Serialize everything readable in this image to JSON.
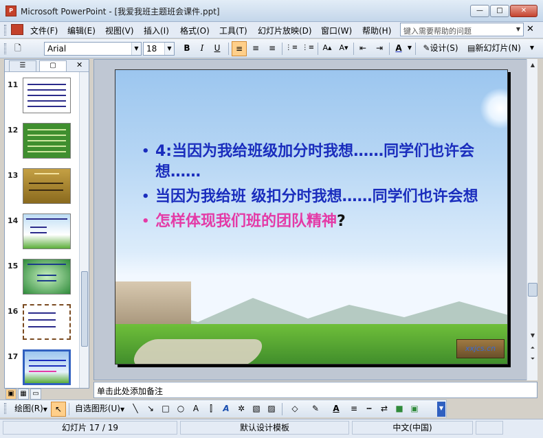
{
  "window": {
    "app_icon": "P",
    "title": "Microsoft PowerPoint - [我爱我班主题班会课件.ppt]",
    "minimize_glyph": "—",
    "maximize_glyph": "□",
    "close_glyph": "✕"
  },
  "menu": {
    "items": [
      "文件(F)",
      "编辑(E)",
      "视图(V)",
      "插入(I)",
      "格式(O)",
      "工具(T)",
      "幻灯片放映(D)",
      "窗口(W)",
      "帮助(H)"
    ],
    "help_placeholder": "键入需要帮助的问题",
    "help_dropdown_glyph": "▼",
    "close_glyph": "✕"
  },
  "toolbar": {
    "new_glyph": "🗋",
    "font": "Arial",
    "font_size": "18",
    "bold": "B",
    "italic": "I",
    "underline": "U",
    "align_left_glyph": "≡",
    "align_center_glyph": "≡",
    "align_right_glyph": "≡",
    "numbering_glyph": "⋮≡",
    "bullets_glyph": "⋮≡",
    "grow_glyph": "A▴",
    "shrink_glyph": "A▾",
    "outdent_glyph": "⇤",
    "indent_glyph": "⇥",
    "font_color_glyph": "A",
    "design_label": "设计(S)",
    "new_slide_label": "新幻灯片(N)"
  },
  "left_pane": {
    "tab_outline_glyph": "☰",
    "tab_slides_glyph": "▢",
    "close_glyph": "✕",
    "thumbnails": [
      {
        "number": "11"
      },
      {
        "number": "12"
      },
      {
        "number": "13"
      },
      {
        "number": "14"
      },
      {
        "number": "15"
      },
      {
        "number": "16"
      },
      {
        "number": "17",
        "selected": true
      }
    ]
  },
  "slide": {
    "bullet_glyph": "•",
    "bullets": [
      {
        "prefix": "4:",
        "text": "当因为我给班级加分时我想……同学们也许会想……",
        "color": "#1a2dbd"
      },
      {
        "prefix": "",
        "text": "当因为我给班 级扣分时我想……同学们也许会想",
        "color": "#1a2dbd"
      },
      {
        "prefix": "",
        "text": "怎样体现我们班的团队精神",
        "suffix": "?",
        "color": "#e43aa6"
      }
    ],
    "logo_text": "xxjcs.cn"
  },
  "notes": {
    "placeholder": "单击此处添加备注"
  },
  "draw_toolbar": {
    "draw_label": "绘图(R)",
    "autoshapes_label": "自选图形(U)",
    "line_glyph": "╲",
    "arrow_glyph": "↘",
    "rect_glyph": "□",
    "oval_glyph": "○",
    "textbox_glyph": "A",
    "fill_glyph": "◇",
    "line_color_glyph": "✎",
    "font_color_glyph": "A",
    "line_style_glyph": "≡",
    "dash_style_glyph": "┅",
    "arrow_style_glyph": "⇄",
    "shadow_glyph": "■",
    "threed_glyph": "▣"
  },
  "status": {
    "slide_position": "幻灯片 17 / 19",
    "design_template": "默认设计模板",
    "language": "中文(中国)"
  },
  "colors": {
    "accent": "#3060c0",
    "bullet_blue": "#1a2dbd",
    "bullet_pink": "#e43aa6"
  }
}
